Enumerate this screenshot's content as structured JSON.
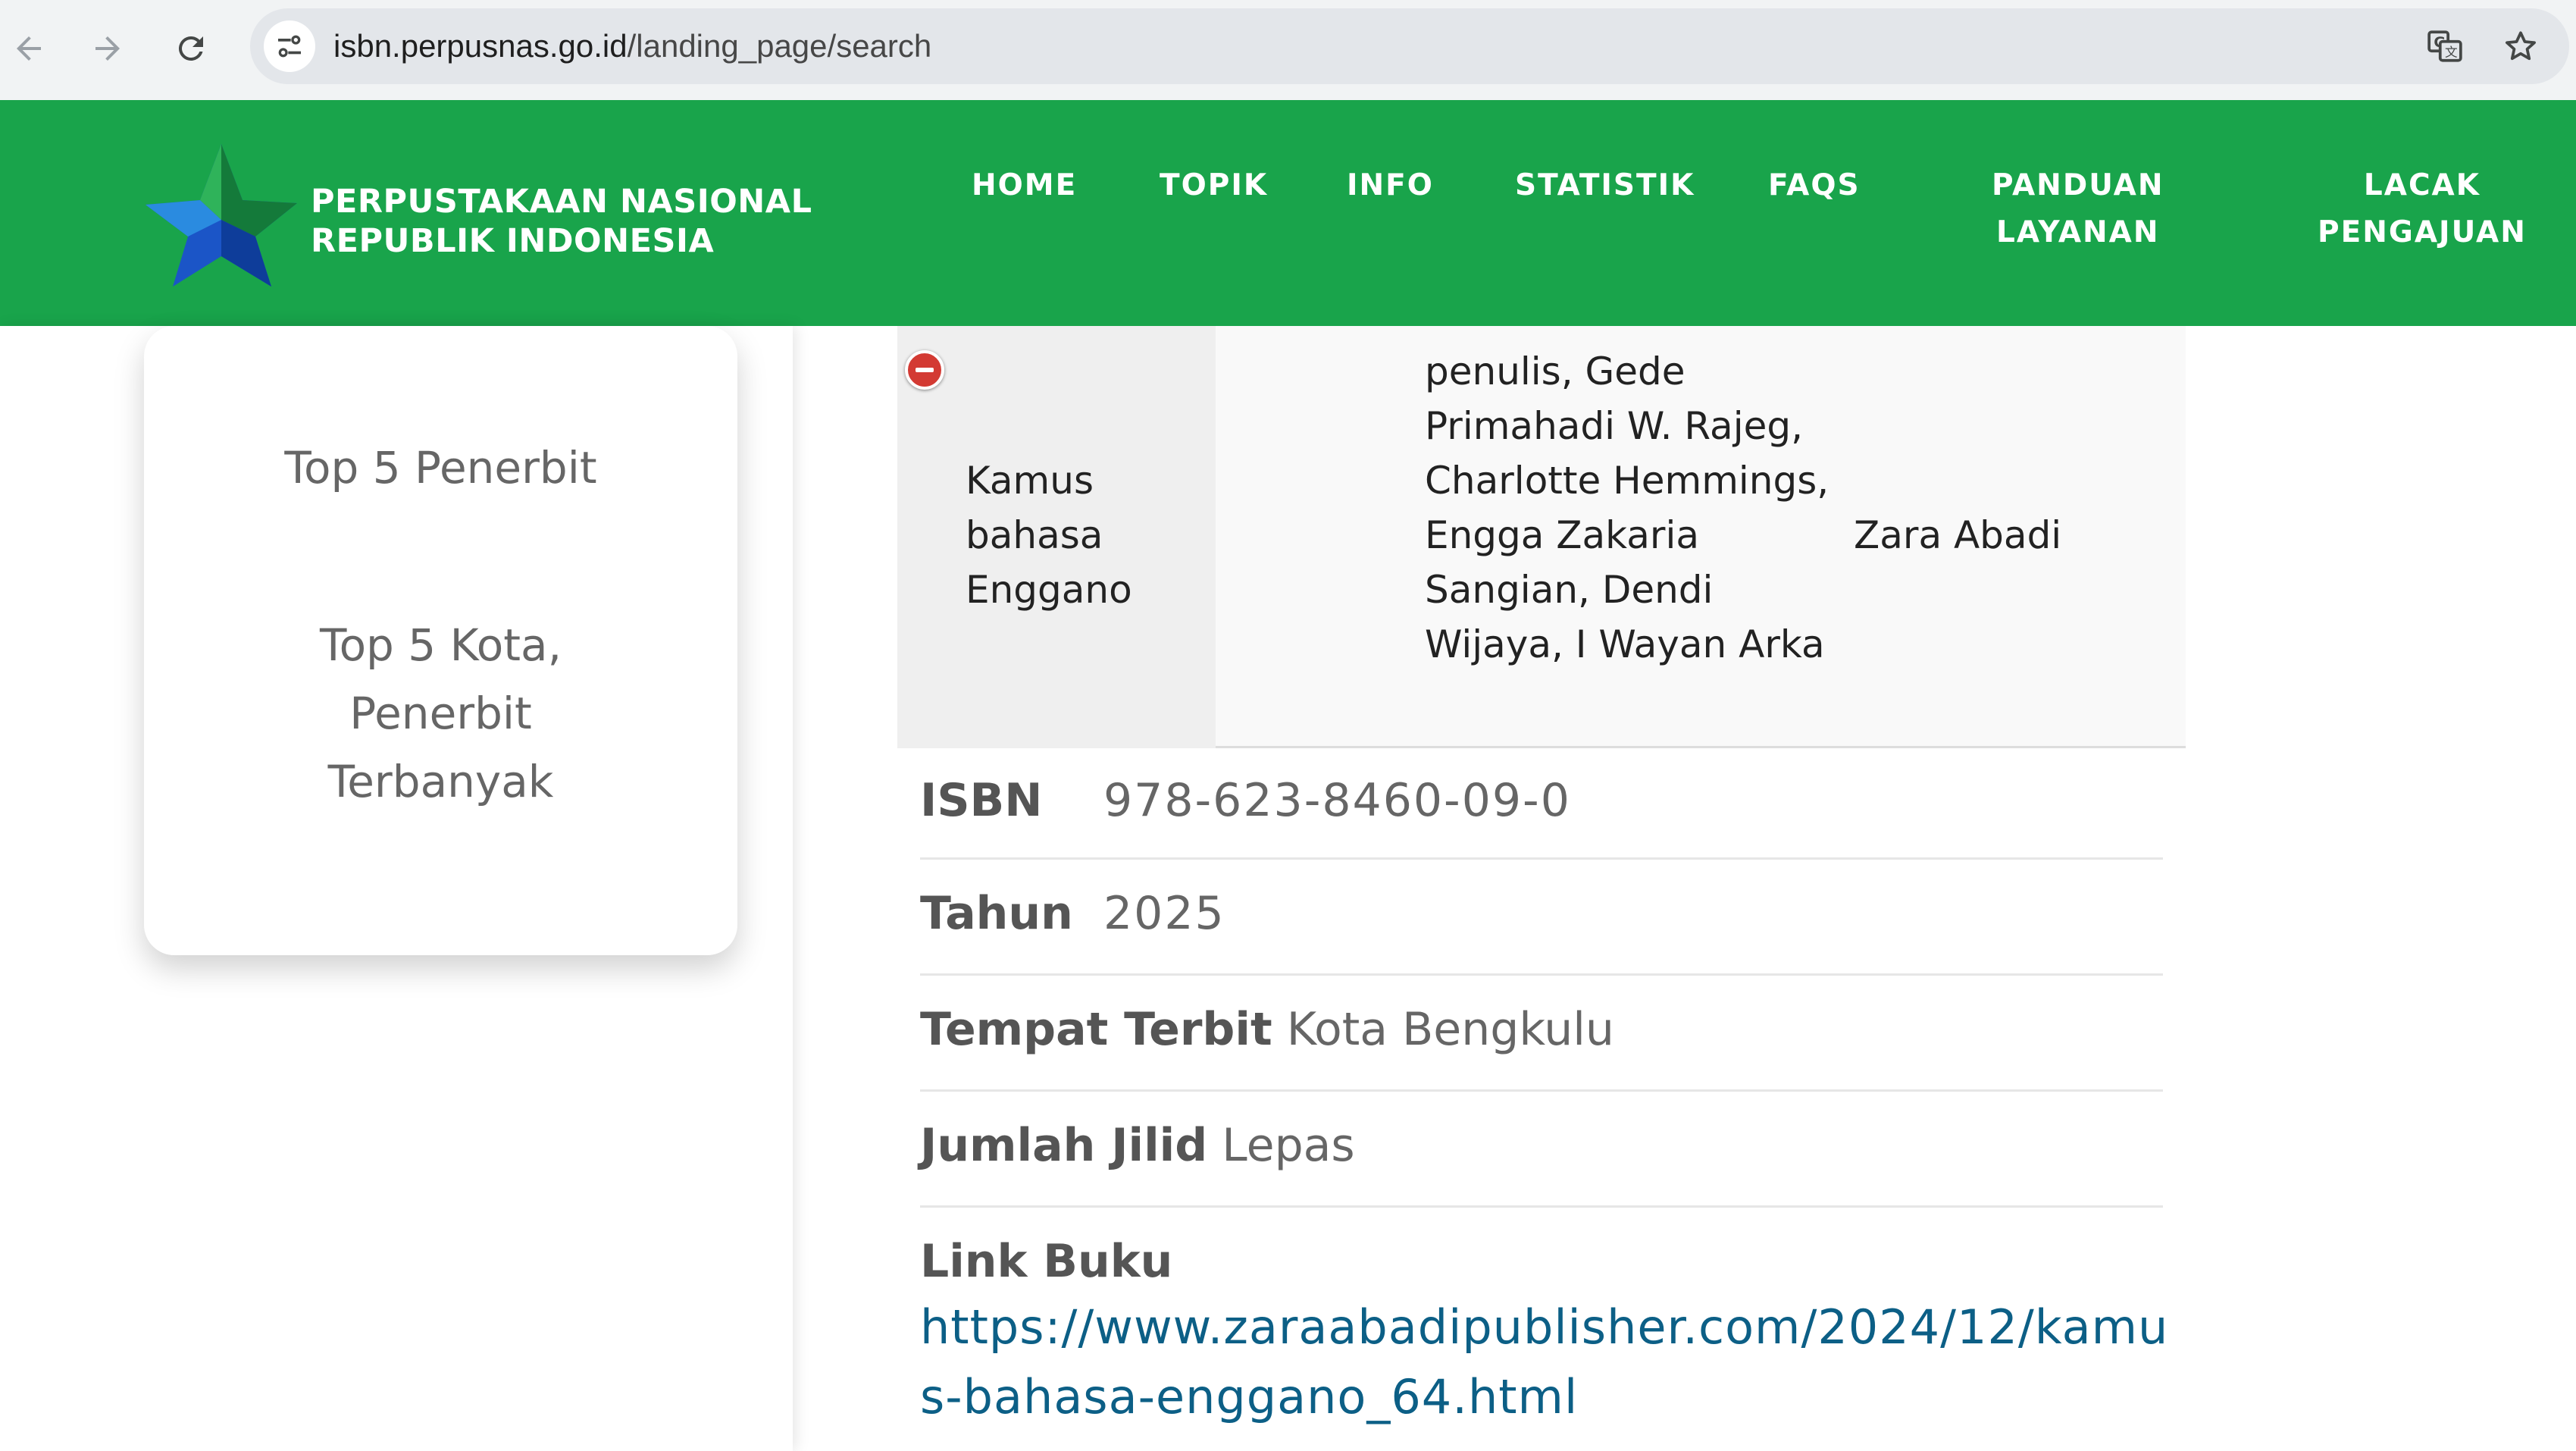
{
  "browser": {
    "url_domain": "isbn.perpusnas.go.id",
    "url_path": "/landing_page/search"
  },
  "header": {
    "logo_line1": "PERPUSTAKAAN NASIONAL",
    "logo_line2": "REPUBLIK INDONESIA",
    "menu": [
      {
        "line1": "HOME",
        "line2": ""
      },
      {
        "line1": "TOPIK",
        "line2": ""
      },
      {
        "line1": "INFO",
        "line2": ""
      },
      {
        "line1": "STATISTIK",
        "line2": ""
      },
      {
        "line1": "FAQS",
        "line2": ""
      },
      {
        "line1": "PANDUAN",
        "line2": "LAYANAN"
      },
      {
        "line1": "LACAK",
        "line2": "PENGAJUAN"
      }
    ],
    "brand_color": "#19a44b"
  },
  "sidebar": {
    "links": [
      "Top 5 Penerbit",
      "Top 5 Kota, Penerbit Terbanyak"
    ]
  },
  "result": {
    "title": "Kamus bahasa Enggano",
    "authors": "penulis, Gede Primahadi W. Rajeg, Charlotte Hemmings, Engga Zakaria Sangian, Dendi Wijaya, I Wayan Arka",
    "publisher": "Zara Abadi"
  },
  "details": {
    "isbn_label": "ISBN",
    "isbn_value": "978-623-8460-09-0",
    "tahun_label": "Tahun",
    "tahun_value": "2025",
    "tempat_label": "Tempat Terbit",
    "tempat_value": "Kota Bengkulu",
    "jilid_label": "Jumlah Jilid",
    "jilid_value": "Lepas",
    "link_label": "Link Buku",
    "link_value": "https://www.zaraabadipublisher.com/2024/12/kamus-bahasa-enggano_64.html",
    "link_color": "#0c5f86"
  }
}
